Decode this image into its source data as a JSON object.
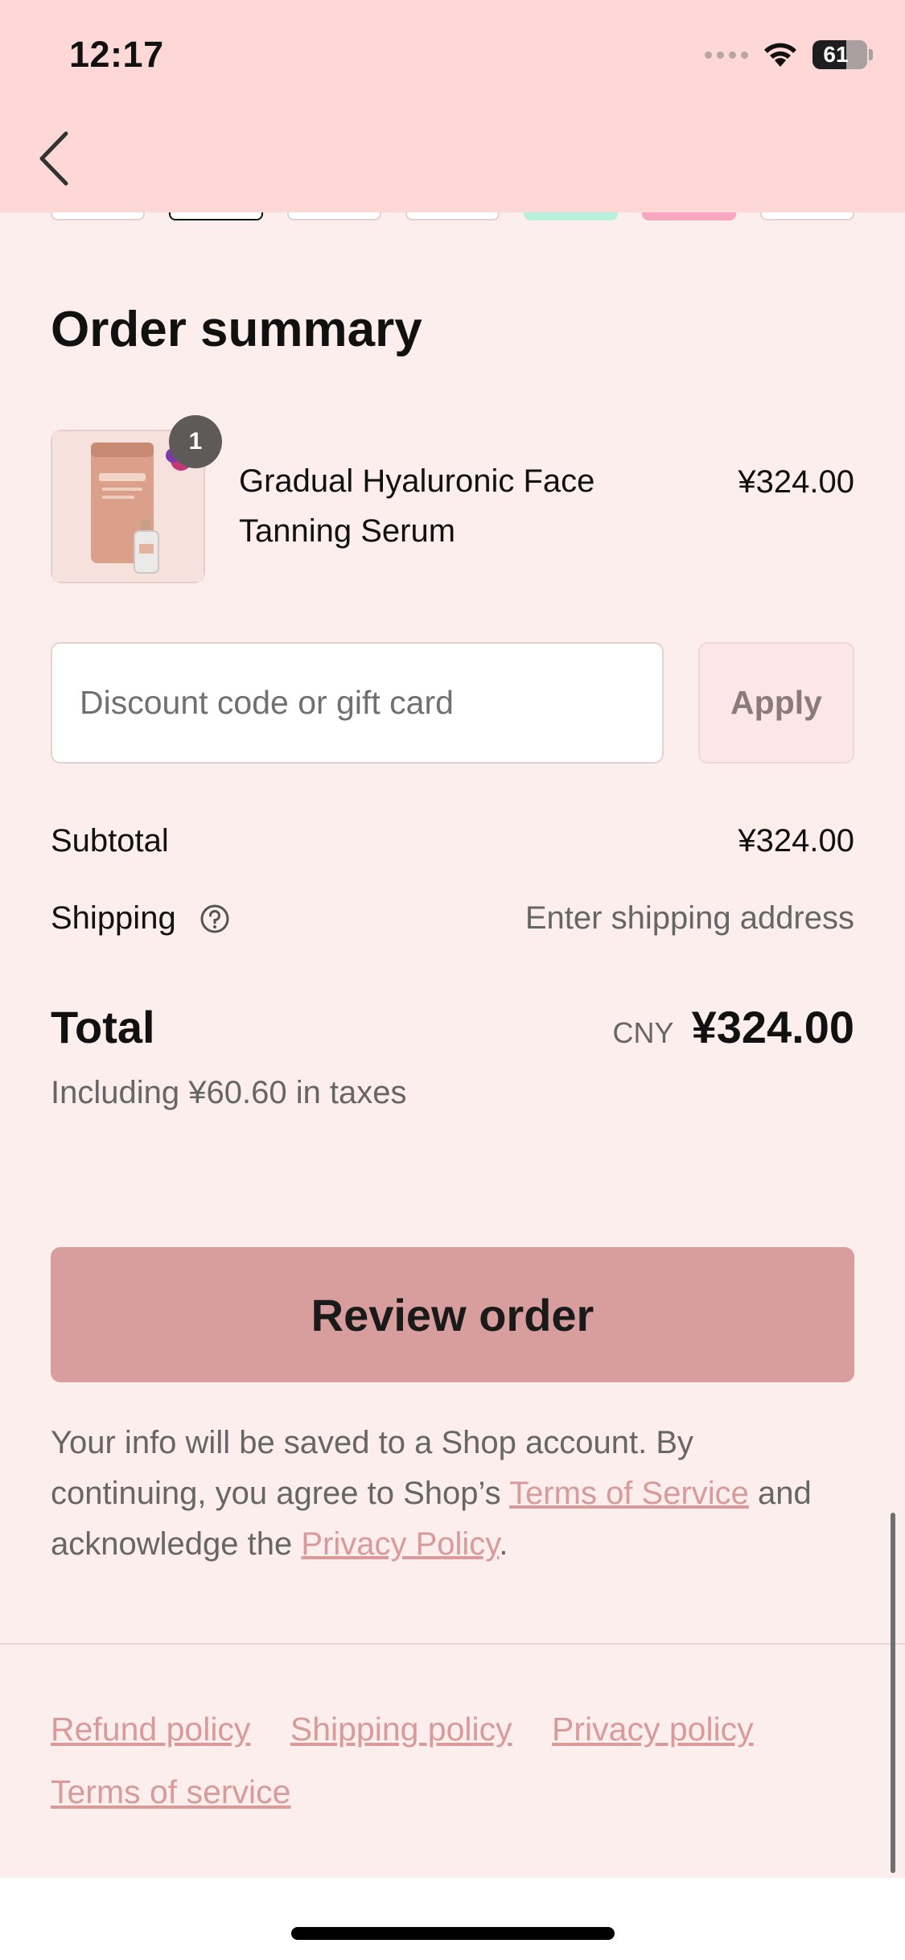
{
  "status_bar": {
    "time": "12:17",
    "battery": "61"
  },
  "header": {
    "back_icon": "chevron-left-icon"
  },
  "order_summary": {
    "title": "Order summary",
    "item": {
      "quantity": "1",
      "name": "Gradual Hyaluronic Face Tanning Serum",
      "price": "¥324.00"
    }
  },
  "discount": {
    "placeholder": "Discount code or gift card",
    "apply_label": "Apply"
  },
  "totals": {
    "subtotal_label": "Subtotal",
    "subtotal_value": "¥324.00",
    "shipping_label": "Shipping",
    "shipping_value": "Enter shipping address",
    "total_label": "Total",
    "currency": "CNY",
    "total_value": "¥324.00",
    "taxes_note": "Including ¥60.60 in taxes"
  },
  "review_button": "Review order",
  "legal": {
    "text_1": "Your info will be saved to a Shop account. By continuing, you agree to Shop’s ",
    "terms_link": "Terms of Service",
    "text_2": " and acknowledge the ",
    "privacy_link": "Privacy Policy",
    "text_3": "."
  },
  "footer_links": {
    "refund": "Refund policy",
    "shipping": "Shipping policy",
    "privacy": "Privacy policy",
    "terms": "Terms of service"
  },
  "colors": {
    "header_bg": "#fdd8d6",
    "page_bg": "#fdeeee",
    "primary_button": "#d89e9e",
    "link": "#d99a9a"
  }
}
